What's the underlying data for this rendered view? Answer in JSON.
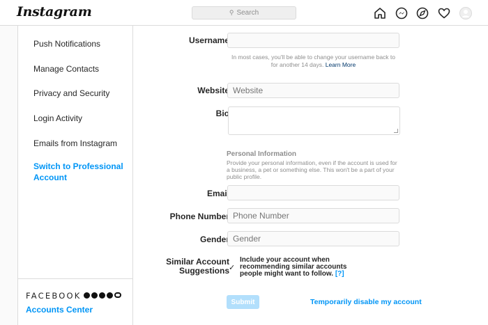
{
  "app": {
    "logo": "Instagram"
  },
  "search": {
    "placeholder": "Search",
    "icon": "search-icon"
  },
  "nav": {
    "icons": [
      "home-icon",
      "messenger-icon",
      "explore-icon",
      "heart-icon",
      "avatar"
    ]
  },
  "sidebar": {
    "items": [
      {
        "label": "Push Notifications"
      },
      {
        "label": "Manage Contacts"
      },
      {
        "label": "Privacy and Security"
      },
      {
        "label": "Login Activity"
      },
      {
        "label": "Emails from Instagram"
      },
      {
        "label": "Switch to Professional Account"
      }
    ],
    "facebook": {
      "wordmark": "FACEBOOK",
      "accounts_center": "Accounts Center"
    }
  },
  "form": {
    "username": {
      "label": "Username",
      "value": ""
    },
    "username_help": "In most cases, you'll be able to change your username back to for another 14 days.",
    "username_help_link": "Learn More",
    "website": {
      "label": "Website",
      "placeholder": "Website"
    },
    "bio": {
      "label": "Bio"
    },
    "personal_info": {
      "title": "Personal Information",
      "description": "Provide your personal information, even if the account is used for a business, a pet or something else. This won't be a part of your public profile."
    },
    "email": {
      "label": "Email",
      "value": ""
    },
    "phone": {
      "label": "Phone Number",
      "placeholder": "Phone Number"
    },
    "gender": {
      "label": "Gender",
      "placeholder": "Gender"
    },
    "similar": {
      "label": "Similar Account Suggestions",
      "checkbox_text": "Include your account when recommending similar accounts people might want to follow.",
      "help_link": "[?]",
      "checked": true
    },
    "submit_label": "Submit",
    "disable_label": "Temporarily disable my account"
  },
  "colors": {
    "accent": "#0095f6",
    "submit_disabled": "#b2dffc",
    "border": "#dbdbdb"
  }
}
